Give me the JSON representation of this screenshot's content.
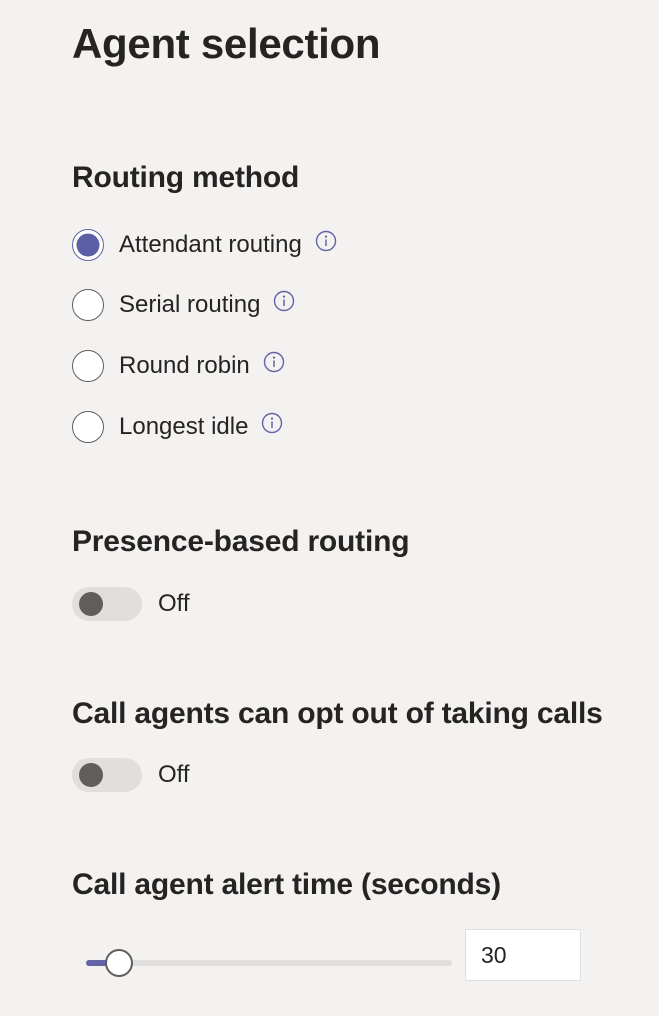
{
  "page_title": "Agent selection",
  "routing_method": {
    "title": "Routing method",
    "selected": "Attendant routing",
    "options": [
      {
        "label": "Attendant routing",
        "checked": true,
        "info_icon": "info-icon"
      },
      {
        "label": "Serial routing",
        "checked": false,
        "info_icon": "info-icon"
      },
      {
        "label": "Round robin",
        "checked": false,
        "info_icon": "info-icon"
      },
      {
        "label": "Longest idle",
        "checked": false,
        "info_icon": "info-icon"
      }
    ]
  },
  "presence_routing": {
    "title": "Presence-based routing",
    "state": "Off",
    "on": false
  },
  "opt_out": {
    "title": "Call agents can opt out of taking calls",
    "state": "Off",
    "on": false
  },
  "alert_time": {
    "title": "Call agent alert time (seconds)",
    "value": "30",
    "slider_fraction": 0.09
  },
  "colors": {
    "accent": "#6264a7",
    "background": "#f3f2f1",
    "text": "#252423",
    "toggle_off_track": "#e1dfdd",
    "toggle_off_knob": "#605e5c"
  }
}
